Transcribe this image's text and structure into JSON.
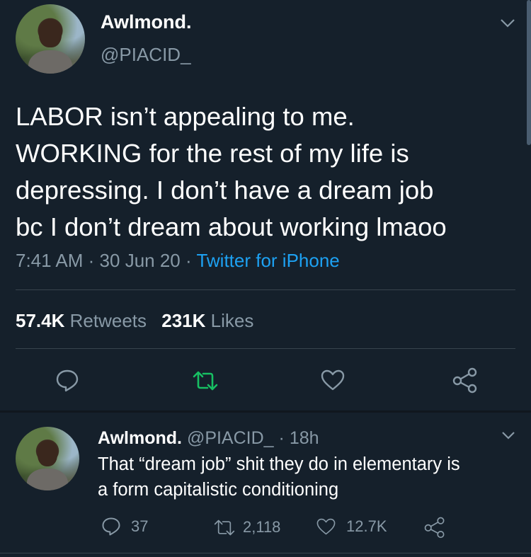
{
  "main_tweet": {
    "display_name": "Awlmond.",
    "handle": "@PIACID_",
    "text_lines": [
      "LABOR isn’t appealing to me.",
      "WORKING for the rest of my life is",
      "depressing. I don’t have a dream job",
      "bc I don’t dream about working lmaoo"
    ],
    "time": "7:41 AM",
    "sep": "·",
    "date": "30 Jun 20",
    "source": "Twitter for iPhone",
    "retweets_count": "57.4K",
    "retweets_label": "Retweets",
    "likes_count": "231K",
    "likes_label": "Likes"
  },
  "reply": {
    "display_name": "Awlmond.",
    "handle": "@PIACID_",
    "sep": "·",
    "time_ago": "18h",
    "text_lines": [
      "That “dream job” shit they do in elementary is",
      "a form capitalistic conditioning"
    ],
    "reply_count": "37",
    "retweet_count": "2,118",
    "like_count": "12.7K"
  },
  "icons": {
    "reply": "reply-icon",
    "retweet": "retweet-icon",
    "like": "heart-icon",
    "share": "share-icon",
    "more": "chevron-down-icon"
  },
  "colors": {
    "background": "#15202b",
    "link": "#1da1f2",
    "retweet_active": "#17bf63",
    "muted": "#8899a6"
  }
}
